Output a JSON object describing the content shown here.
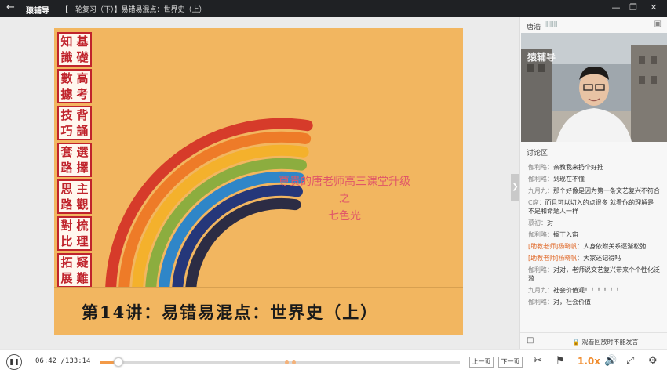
{
  "window": {
    "app_name": "猿辅导",
    "lesson_title": "【一轮复习（下）】易错易混点：世界史（上）",
    "icons": [
      "back-arrow-icon",
      "minimize-icon",
      "restore-icon",
      "close-icon"
    ]
  },
  "slide": {
    "seals": [
      [
        "知",
        "基",
        "識",
        "礎"
      ],
      [
        "數",
        "高",
        "據",
        "考"
      ],
      [
        "技",
        "背",
        "巧",
        "誦"
      ],
      [
        "套",
        "選",
        "路",
        "擇"
      ],
      [
        "思",
        "主",
        "路",
        "觀"
      ],
      [
        "對",
        "梳",
        "比",
        "理"
      ],
      [
        "拓",
        "疑",
        "展",
        "難"
      ]
    ],
    "title_line1": "尊贵的唐老师高三课堂升级",
    "title_line2": "之",
    "title_line3": "七色光",
    "footer": "第14讲：易错易混点：世界史（上）",
    "rainbow_colors": [
      "#d63b2a",
      "#ee7b28",
      "#f4b12c",
      "#8cad3f",
      "#2f86c8",
      "#25377a",
      "#2c2c44"
    ]
  },
  "teacher": {
    "name": "唐浩",
    "signal_bars": "||||||||||",
    "video_watermark": "猿辅导"
  },
  "chat": {
    "label": "讨论区",
    "messages": [
      {
        "user": "伽利略",
        "text": "亲教我来扔个好推",
        "role": false
      },
      {
        "user": "伽利略",
        "text": "到现在不懂",
        "role": false
      },
      {
        "user": "九月九",
        "text": "那个好像是因为第一条文艺复兴不符合",
        "role": false
      },
      {
        "user": "C席",
        "text": "而且可以切入的点很多 就看你的理解是不是和命题人一样",
        "role": false
      },
      {
        "user": "慕初",
        "text": "对",
        "role": false
      },
      {
        "user": "伽利略",
        "text": "搁丁入宙",
        "role": false
      },
      {
        "user": "[助教老师]杨晓帆",
        "text": "人身依附关系逐渐松弛",
        "role": true
      },
      {
        "user": "[助教老师]杨晓帆",
        "text": "大家还记得吗",
        "role": true
      },
      {
        "user": "伽利略",
        "text": "对对，老师说文艺复兴带来个个性化泛滥",
        "role": false
      },
      {
        "user": "九月九",
        "text": "社会价值观！！！！！！",
        "role": false
      },
      {
        "user": "伽利略",
        "text": "对，社会价值",
        "role": false
      }
    ],
    "footer_notice": "观看回放时不能发言"
  },
  "player": {
    "current_time": "06:42",
    "total_time": "/133:14",
    "progress": 0.05,
    "prev_page": "上一页",
    "next_page": "下一页",
    "speed": "1.0x"
  }
}
